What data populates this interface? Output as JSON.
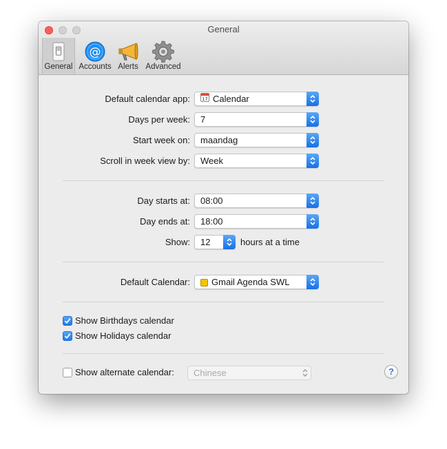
{
  "window": {
    "title": "General"
  },
  "toolbar": {
    "items": [
      {
        "label": "General",
        "icon": "general-switch-icon",
        "selected": true
      },
      {
        "label": "Accounts",
        "icon": "at-sign-icon",
        "selected": false
      },
      {
        "label": "Alerts",
        "icon": "megaphone-icon",
        "selected": false
      },
      {
        "label": "Advanced",
        "icon": "gear-icon",
        "selected": false
      }
    ]
  },
  "settings": {
    "default_app": {
      "label": "Default calendar app:",
      "value": "Calendar",
      "icon": "calendar-icon"
    },
    "days_per_week": {
      "label": "Days per week:",
      "value": "7"
    },
    "start_week": {
      "label": "Start week on:",
      "value": "maandag"
    },
    "scroll_by": {
      "label": "Scroll in week view by:",
      "value": "Week"
    },
    "day_starts": {
      "label": "Day starts at:",
      "value": "08:00"
    },
    "day_ends": {
      "label": "Day ends at:",
      "value": "18:00"
    },
    "show": {
      "label": "Show:",
      "value": "12",
      "suffix": "hours at a time"
    },
    "default_calendar": {
      "label": "Default Calendar:",
      "value": "Gmail Agenda SWL",
      "swatch_color": "#f5c400"
    },
    "birthdays": {
      "label": "Show Birthdays calendar",
      "checked": true
    },
    "holidays": {
      "label": "Show Holidays calendar",
      "checked": true
    },
    "alternate": {
      "label": "Show alternate calendar:",
      "checked": false,
      "value": "Chinese"
    }
  },
  "help": {
    "label": "?"
  },
  "colors": {
    "accent": "#1770e6",
    "close": "#fc5f57"
  }
}
